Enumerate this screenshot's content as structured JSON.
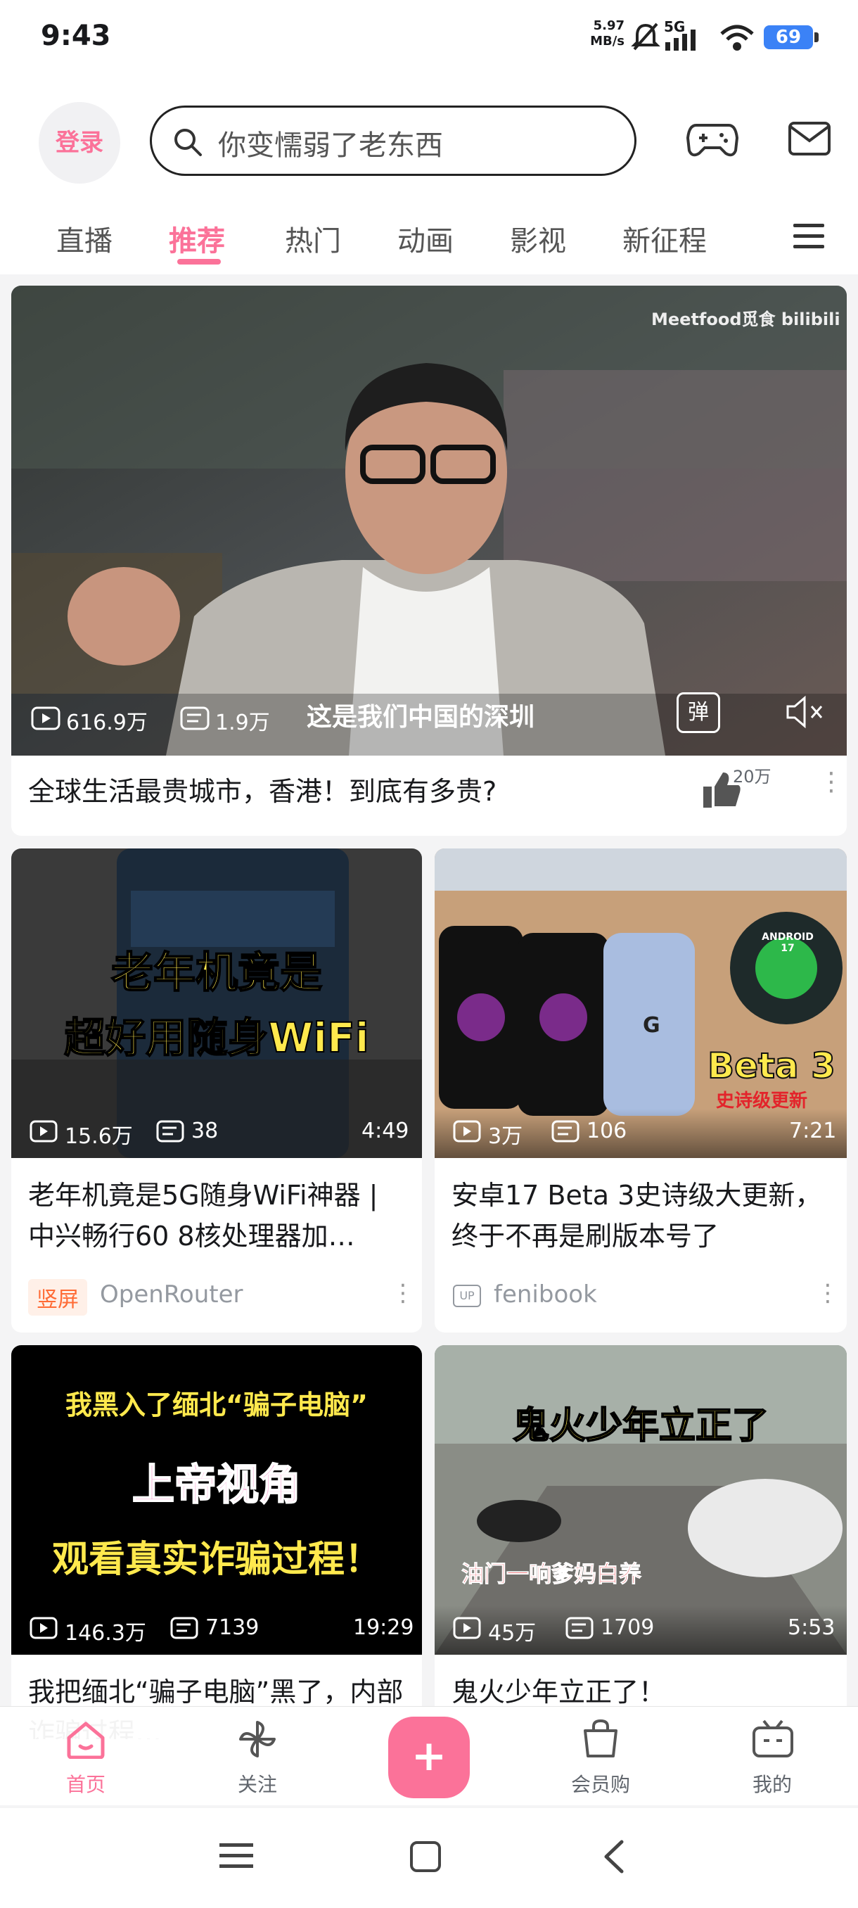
{
  "status_bar": {
    "time": "9:43",
    "net_speed": "5.97",
    "net_unit": "MB/s",
    "signal": "5G",
    "battery": "69"
  },
  "header": {
    "login_label": "登录",
    "search_placeholder": "你变懦弱了老东西",
    "tabs": [
      {
        "label": "直播"
      },
      {
        "label": "推荐",
        "active": true
      },
      {
        "label": "热门"
      },
      {
        "label": "动画"
      },
      {
        "label": "影视"
      },
      {
        "label": "新征程"
      }
    ]
  },
  "hero": {
    "watermark": "Meetfood觅食 bilibili",
    "views": "616.9万",
    "comments": "1.9万",
    "subtitle": "这是我们中国的深圳",
    "danmaku_icon": "弹",
    "title": "全球生活最贵城市，香港！到底有多贵?",
    "likes": "20万"
  },
  "cards": [
    {
      "cover_text_lines": [
        "老年机竟是",
        "超好用随身WiFi"
      ],
      "views": "15.6万",
      "comments": "38",
      "duration": "4:49",
      "title": "老年机竟是5G随身WiFi神器 | 中兴畅行60 8核处理器加…",
      "tag": "竖屏",
      "author": "OpenRouter"
    },
    {
      "cover_text_lines": [
        "Beta 3",
        "史诗级更新"
      ],
      "android_badge": "ANDROID 17",
      "phone_logo": "G",
      "views": "3万",
      "comments": "106",
      "duration": "7:21",
      "title": "安卓17 Beta 3史诗级大更新，终于不再是刷版本号了",
      "tag": "UP",
      "author": "fenibook"
    },
    {
      "cover_text_lines": [
        "我黑入了缅北“骗子电脑”",
        "上帝视角",
        "观看真实诈骗过程！"
      ],
      "views": "146.3万",
      "comments": "7139",
      "duration": "19:29",
      "title": "我把缅北“骗子电脑”黑了，内部诈骗过程…"
    },
    {
      "cover_text_lines": [
        "鬼火少年立正了",
        "油门一响爹妈白养"
      ],
      "views": "45万",
      "comments": "1709",
      "duration": "5:53",
      "title": "鬼火少年立正了！"
    }
  ],
  "bottom_nav": [
    {
      "label": "首页",
      "icon": "home-icon",
      "active": true
    },
    {
      "label": "关注",
      "icon": "pinwheel-icon"
    },
    {
      "label": "+",
      "icon": "plus-icon"
    },
    {
      "label": "会员购",
      "icon": "shopping-bag-icon"
    },
    {
      "label": "我的",
      "icon": "tv-icon"
    }
  ],
  "colors": {
    "accent": "#fb7299",
    "tag_orange": "#ff6b35",
    "text": "#18191c"
  }
}
